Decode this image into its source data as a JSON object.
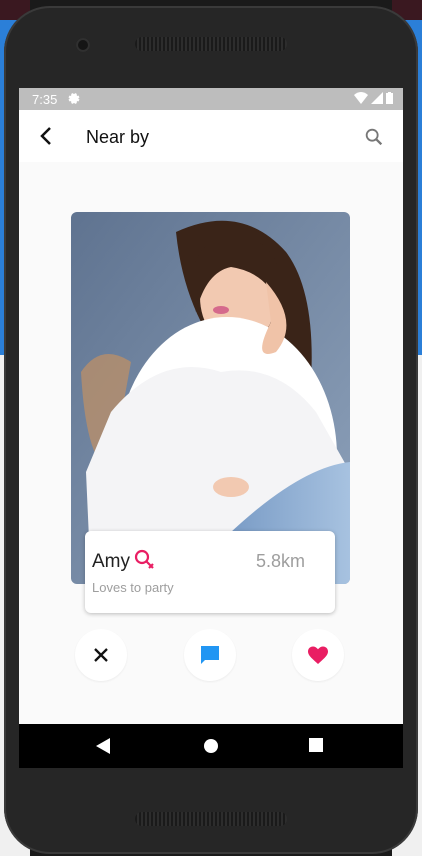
{
  "status_bar": {
    "time": "7:35"
  },
  "app_bar": {
    "title": "Near by"
  },
  "profile": {
    "name": "Amy",
    "distance": "5.8km",
    "status": "Loves to party"
  },
  "colors": {
    "accent_pink": "#e91e63",
    "chat_blue": "#2196f3",
    "secondary_text": "#9e9e9e"
  },
  "icons": {
    "back": "back-arrow-icon",
    "search": "search-icon",
    "gender": "female-icon",
    "dislike": "close-icon",
    "chat": "chat-icon",
    "like": "heart-icon"
  }
}
